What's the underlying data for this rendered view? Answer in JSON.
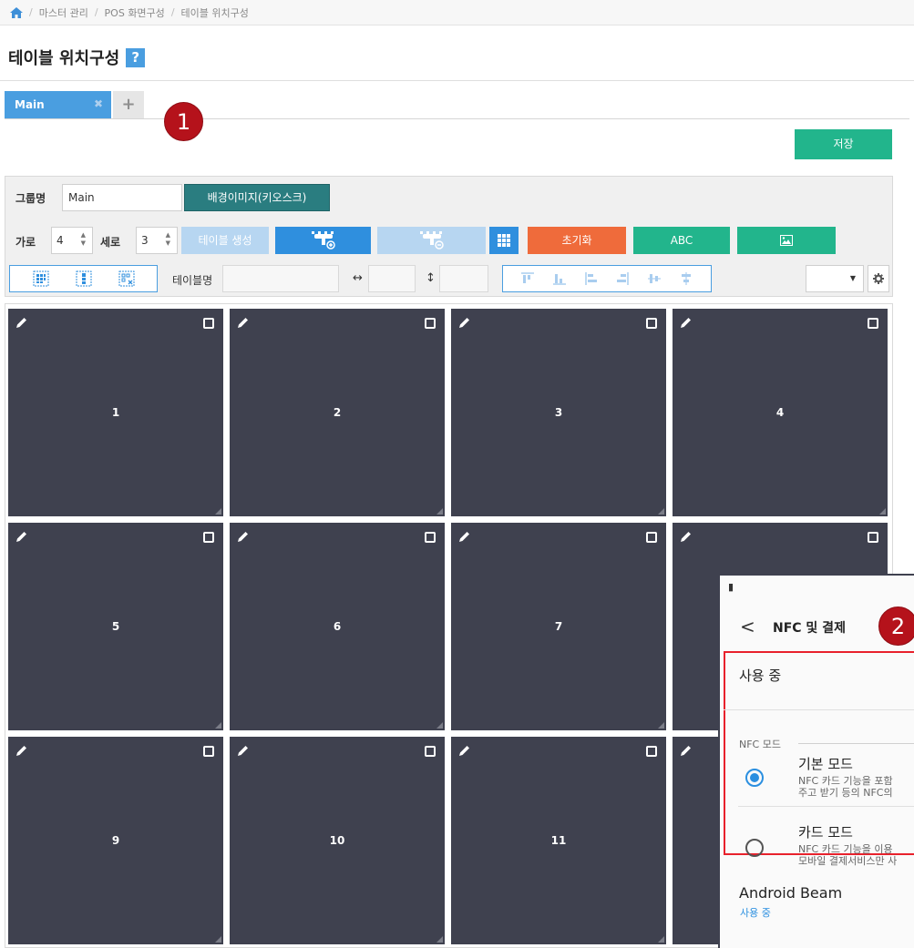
{
  "breadcrumb": {
    "items": [
      "마스터 관리",
      "POS 화면구성",
      "테이블 위치구성"
    ]
  },
  "page": {
    "title": "테이블 위치구성",
    "help": "?"
  },
  "tabs": [
    {
      "label": "Main",
      "close": "✖"
    }
  ],
  "tab_add": "+",
  "callouts": [
    "1",
    "2"
  ],
  "actions": {
    "save": "저장"
  },
  "toolbar": {
    "group_label": "그룹명",
    "group_value": "Main",
    "bg_image_button": "배경이미지(키오스크)",
    "cols_label": "가로",
    "cols_value": "4",
    "rows_label": "세로",
    "rows_value": "3",
    "create_tables_button": "테이블 생성",
    "reset_button": "초기화",
    "abc_button": "ABC",
    "table_name_label": "테이블명",
    "width_symbol": "↔",
    "height_symbol": "↕",
    "select_caret": "▼",
    "colors": {
      "blue": "#2f8fde",
      "blue_light": "#b7d6f1",
      "teal": "#2a7d80",
      "orange": "#ef6b3b",
      "green": "#22b58c"
    }
  },
  "tables": [
    "1",
    "2",
    "3",
    "4",
    "5",
    "6",
    "7",
    "",
    "9",
    "10",
    "11",
    ""
  ],
  "phone": {
    "status_icon": "▮",
    "back": "<",
    "title": "NFC 및 결제",
    "in_use": "사용 중",
    "section": "NFC 모드",
    "options": [
      {
        "title": "기본 모드",
        "desc": "NFC 카드 기능을 포함\n주고 받기 등의 NFC의",
        "selected": true
      },
      {
        "title": "카드 모드",
        "desc": "NFC 카드 기능을 이용\n모바일 결제서비스만 사",
        "selected": false
      }
    ],
    "beam": "Android Beam",
    "beam_status": "사용 중"
  }
}
